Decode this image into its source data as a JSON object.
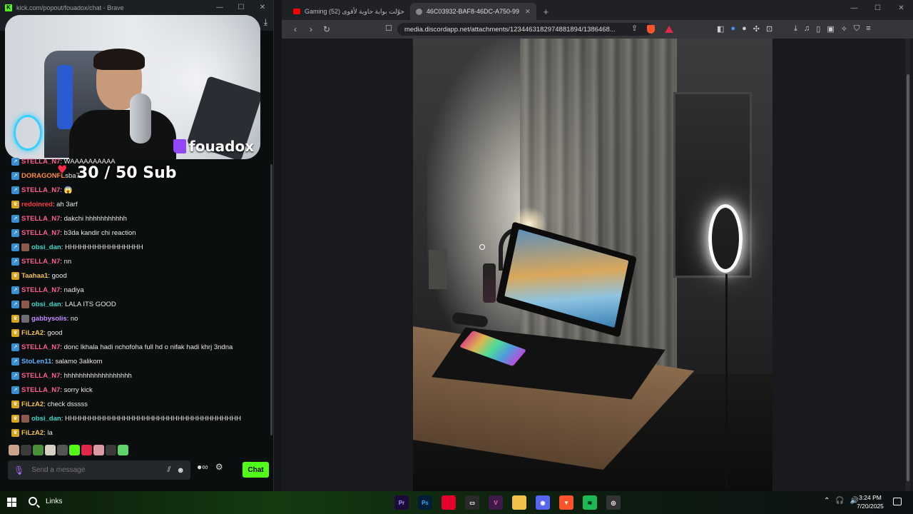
{
  "chat_window": {
    "title": "kick.com/popout/fouadox/chat - Brave",
    "min": "—",
    "max": "☐",
    "close": "✕",
    "download_icon": "⤓",
    "webcam_brand": "fouadox",
    "sub_goal": "30 / 50 Sub",
    "messages": [
      {
        "badge": "blue",
        "user": "STELLA_N7",
        "color": "#ff5f8a",
        "text": ": WAAAAAAAAAA"
      },
      {
        "badge": "blue",
        "user": "DORAGONFL",
        "color": "#ff8c3a",
        "text": "sba7"
      },
      {
        "badge": "blue",
        "user": "STELLA_N7",
        "color": "#ff5f8a",
        "text": ": 😱"
      },
      {
        "badge": "gold",
        "user": "redoinred",
        "color": "#ff3b3b",
        "text": ": ah 3arf"
      },
      {
        "badge": "blue",
        "user": "STELLA_N7",
        "color": "#ff5f8a",
        "text": ": dakchi hhhhhhhhhhh"
      },
      {
        "badge": "blue",
        "user": "STELLA_N7",
        "color": "#ff5f8a",
        "text": ": b3da kandir chi reaction"
      },
      {
        "badge": "blue",
        "avatar": "avatar",
        "user": "obsi_dan",
        "color": "#3fd6c9",
        "text": ": HHHHHHHHHHHHHHHH"
      },
      {
        "badge": "blue",
        "user": "STELLA_N7",
        "color": "#ff5f8a",
        "text": ": nn"
      },
      {
        "badge": "gold",
        "user": "Taahaa1",
        "color": "#f2c14e",
        "text": ": good"
      },
      {
        "badge": "blue",
        "user": "STELLA_N7",
        "color": "#ff5f8a",
        "text": ": nadiya"
      },
      {
        "badge": "blue",
        "avatar": "avatar",
        "user": "obsi_dan",
        "color": "#3fd6c9",
        "text": ": LALA ITS GOOD"
      },
      {
        "badge": "gold",
        "avatar": "avatar2",
        "user": "gabbysolis",
        "color": "#c58aff",
        "text": ": no"
      },
      {
        "badge": "gold",
        "user": "FiLzA2",
        "color": "#f2c14e",
        "text": ": good"
      },
      {
        "badge": "blue",
        "user": "STELLA_N7",
        "color": "#ff5f8a",
        "text": ": donc lkhala hadi nchofoha full hd o nifak hadi khrj 3ndna"
      },
      {
        "badge": "blue",
        "user": "StoLen11",
        "color": "#5ab4ff",
        "text": ": salamo 3alikom"
      },
      {
        "badge": "blue",
        "user": "STELLA_N7",
        "color": "#ff5f8a",
        "text": ": hhhhhhhhhhhhhhhhhh"
      },
      {
        "badge": "blue",
        "user": "STELLA_N7",
        "color": "#ff5f8a",
        "text": ": sorry kick"
      },
      {
        "badge": "gold",
        "user": "FiLzA2",
        "color": "#f2c14e",
        "text": ": check dsssss"
      },
      {
        "badge": "gold",
        "avatar": "avatar",
        "user": "obsi_dan",
        "color": "#3fd6c9",
        "text": ": HHHHHHHHHHHHHHHHHHHHHHHHHHHHHHHHHHHH"
      },
      {
        "badge": "gold",
        "user": "FiLzA2",
        "color": "#f2c14e",
        "text": ": la"
      }
    ],
    "emote_colors": [
      "#c9a48a",
      "#3b3b3b",
      "#4a8f3a",
      "#d9d0c5",
      "#555",
      "#53fc18",
      "#e0284b",
      "#d99aa5",
      "#3a3a3a",
      "#5fd46a"
    ],
    "input_placeholder": "Send a message",
    "chat_button": "Chat"
  },
  "browser": {
    "tabs": [
      {
        "label": "Gaming حوّلت بوابة حاوية لأقوى (52)",
        "fav": "#ff0000",
        "active": false
      },
      {
        "label": "46C03932-BAF8-46DC-A750-99",
        "fav": "#888888",
        "active": true
      }
    ],
    "tab_close": "✕",
    "new_tab": "+",
    "back": "‹",
    "forward": "›",
    "reload": "↻",
    "bookmark": "☐",
    "share": "⇪",
    "url": "media.discordapp.net/attachments/1234463182974881894/1386468..."
  },
  "taskbar": {
    "search_label": "Links",
    "apps": [
      {
        "label": "Pr",
        "bg": "#1c0b3a",
        "fg": "#9999ff"
      },
      {
        "label": "Ps",
        "bg": "#001e36",
        "fg": "#31a8ff"
      },
      {
        "label": "",
        "bg": "#e4002b",
        "fg": "#fff"
      },
      {
        "label": "▭",
        "bg": "#2a2a2a",
        "fg": "#fff"
      },
      {
        "label": "V",
        "bg": "#3d1a4a",
        "fg": "#ff5fa0"
      },
      {
        "label": "",
        "bg": "#f3c14a",
        "fg": "#fff"
      },
      {
        "label": "◉",
        "bg": "#5865f2",
        "fg": "#fff"
      },
      {
        "label": "▼",
        "bg": "#fb542b",
        "fg": "#fff"
      },
      {
        "label": "≋",
        "bg": "#1db954",
        "fg": "#000"
      },
      {
        "label": "◎",
        "bg": "#333",
        "fg": "#fff"
      }
    ],
    "time": "3:24 PM",
    "date": "7/20/2025"
  }
}
